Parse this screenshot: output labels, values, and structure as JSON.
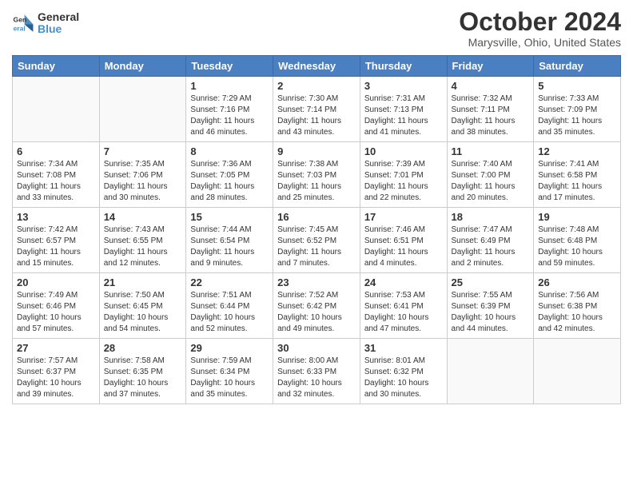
{
  "header": {
    "logo_line1": "General",
    "logo_line2": "Blue",
    "title": "October 2024",
    "subtitle": "Marysville, Ohio, United States"
  },
  "days_of_week": [
    "Sunday",
    "Monday",
    "Tuesday",
    "Wednesday",
    "Thursday",
    "Friday",
    "Saturday"
  ],
  "weeks": [
    [
      {
        "day": "",
        "info": ""
      },
      {
        "day": "",
        "info": ""
      },
      {
        "day": "1",
        "info": "Sunrise: 7:29 AM\nSunset: 7:16 PM\nDaylight: 11 hours and 46 minutes."
      },
      {
        "day": "2",
        "info": "Sunrise: 7:30 AM\nSunset: 7:14 PM\nDaylight: 11 hours and 43 minutes."
      },
      {
        "day": "3",
        "info": "Sunrise: 7:31 AM\nSunset: 7:13 PM\nDaylight: 11 hours and 41 minutes."
      },
      {
        "day": "4",
        "info": "Sunrise: 7:32 AM\nSunset: 7:11 PM\nDaylight: 11 hours and 38 minutes."
      },
      {
        "day": "5",
        "info": "Sunrise: 7:33 AM\nSunset: 7:09 PM\nDaylight: 11 hours and 35 minutes."
      }
    ],
    [
      {
        "day": "6",
        "info": "Sunrise: 7:34 AM\nSunset: 7:08 PM\nDaylight: 11 hours and 33 minutes."
      },
      {
        "day": "7",
        "info": "Sunrise: 7:35 AM\nSunset: 7:06 PM\nDaylight: 11 hours and 30 minutes."
      },
      {
        "day": "8",
        "info": "Sunrise: 7:36 AM\nSunset: 7:05 PM\nDaylight: 11 hours and 28 minutes."
      },
      {
        "day": "9",
        "info": "Sunrise: 7:38 AM\nSunset: 7:03 PM\nDaylight: 11 hours and 25 minutes."
      },
      {
        "day": "10",
        "info": "Sunrise: 7:39 AM\nSunset: 7:01 PM\nDaylight: 11 hours and 22 minutes."
      },
      {
        "day": "11",
        "info": "Sunrise: 7:40 AM\nSunset: 7:00 PM\nDaylight: 11 hours and 20 minutes."
      },
      {
        "day": "12",
        "info": "Sunrise: 7:41 AM\nSunset: 6:58 PM\nDaylight: 11 hours and 17 minutes."
      }
    ],
    [
      {
        "day": "13",
        "info": "Sunrise: 7:42 AM\nSunset: 6:57 PM\nDaylight: 11 hours and 15 minutes."
      },
      {
        "day": "14",
        "info": "Sunrise: 7:43 AM\nSunset: 6:55 PM\nDaylight: 11 hours and 12 minutes."
      },
      {
        "day": "15",
        "info": "Sunrise: 7:44 AM\nSunset: 6:54 PM\nDaylight: 11 hours and 9 minutes."
      },
      {
        "day": "16",
        "info": "Sunrise: 7:45 AM\nSunset: 6:52 PM\nDaylight: 11 hours and 7 minutes."
      },
      {
        "day": "17",
        "info": "Sunrise: 7:46 AM\nSunset: 6:51 PM\nDaylight: 11 hours and 4 minutes."
      },
      {
        "day": "18",
        "info": "Sunrise: 7:47 AM\nSunset: 6:49 PM\nDaylight: 11 hours and 2 minutes."
      },
      {
        "day": "19",
        "info": "Sunrise: 7:48 AM\nSunset: 6:48 PM\nDaylight: 10 hours and 59 minutes."
      }
    ],
    [
      {
        "day": "20",
        "info": "Sunrise: 7:49 AM\nSunset: 6:46 PM\nDaylight: 10 hours and 57 minutes."
      },
      {
        "day": "21",
        "info": "Sunrise: 7:50 AM\nSunset: 6:45 PM\nDaylight: 10 hours and 54 minutes."
      },
      {
        "day": "22",
        "info": "Sunrise: 7:51 AM\nSunset: 6:44 PM\nDaylight: 10 hours and 52 minutes."
      },
      {
        "day": "23",
        "info": "Sunrise: 7:52 AM\nSunset: 6:42 PM\nDaylight: 10 hours and 49 minutes."
      },
      {
        "day": "24",
        "info": "Sunrise: 7:53 AM\nSunset: 6:41 PM\nDaylight: 10 hours and 47 minutes."
      },
      {
        "day": "25",
        "info": "Sunrise: 7:55 AM\nSunset: 6:39 PM\nDaylight: 10 hours and 44 minutes."
      },
      {
        "day": "26",
        "info": "Sunrise: 7:56 AM\nSunset: 6:38 PM\nDaylight: 10 hours and 42 minutes."
      }
    ],
    [
      {
        "day": "27",
        "info": "Sunrise: 7:57 AM\nSunset: 6:37 PM\nDaylight: 10 hours and 39 minutes."
      },
      {
        "day": "28",
        "info": "Sunrise: 7:58 AM\nSunset: 6:35 PM\nDaylight: 10 hours and 37 minutes."
      },
      {
        "day": "29",
        "info": "Sunrise: 7:59 AM\nSunset: 6:34 PM\nDaylight: 10 hours and 35 minutes."
      },
      {
        "day": "30",
        "info": "Sunrise: 8:00 AM\nSunset: 6:33 PM\nDaylight: 10 hours and 32 minutes."
      },
      {
        "day": "31",
        "info": "Sunrise: 8:01 AM\nSunset: 6:32 PM\nDaylight: 10 hours and 30 minutes."
      },
      {
        "day": "",
        "info": ""
      },
      {
        "day": "",
        "info": ""
      }
    ]
  ]
}
